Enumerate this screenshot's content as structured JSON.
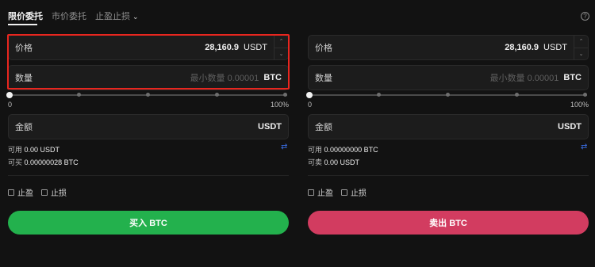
{
  "tabs": [
    {
      "label": "限价委托"
    },
    {
      "label": "市价委托"
    },
    {
      "label": "止盈止损"
    }
  ],
  "help_icon": "question-circle-icon",
  "buy": {
    "price_label": "价格",
    "price_value": "28,160.9",
    "price_unit": "USDT",
    "qty_label": "数量",
    "qty_placeholder": "最小数量 0.00001",
    "qty_unit": "BTC",
    "slider_min": "0",
    "slider_max": "100%",
    "slider_value": 0,
    "amount_label": "金额",
    "amount_unit": "USDT",
    "available_label": "可用",
    "available_value": "0.00 USDT",
    "can_buy_label": "可买",
    "can_buy_value": "0.00000028 BTC",
    "take_profit": "止盈",
    "stop_loss": "止损",
    "button": "买入 BTC"
  },
  "sell": {
    "price_label": "价格",
    "price_value": "28,160.9",
    "price_unit": "USDT",
    "qty_label": "数量",
    "qty_placeholder": "最小数量 0.00001",
    "qty_unit": "BTC",
    "slider_min": "0",
    "slider_max": "100%",
    "slider_value": 0,
    "amount_label": "金额",
    "amount_unit": "USDT",
    "available_label": "可用",
    "available_value": "0.00000000 BTC",
    "can_sell_label": "可卖",
    "can_sell_value": "0.00 USDT",
    "take_profit": "止盈",
    "stop_loss": "止损",
    "button": "卖出 BTC"
  },
  "colors": {
    "buy": "#23b14d",
    "sell": "#d23c60",
    "highlight": "#e8261f",
    "swap": "#3b6fe8"
  }
}
